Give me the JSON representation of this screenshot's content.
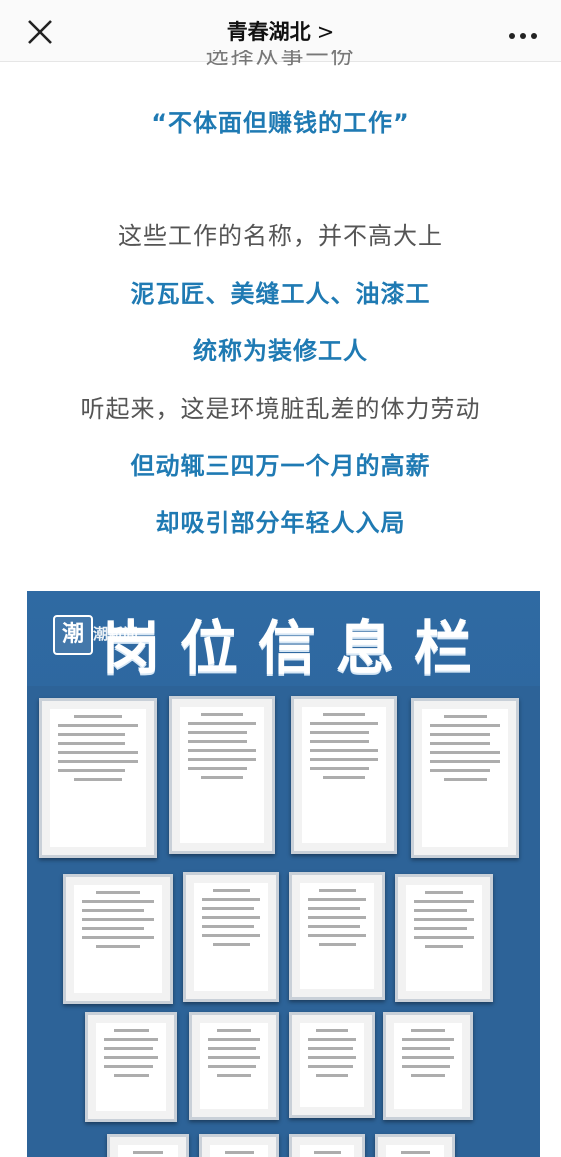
{
  "header": {
    "title": "青春湖北",
    "title_chevron": ">",
    "close_icon": "close-icon",
    "more_icon": "more-icon"
  },
  "article": {
    "cut_line": "选择从事一份",
    "lines": [
      "“不体面但赚钱的工作”",
      "这些工作的名称，并不高大上",
      "泥瓦匠、美缝工人、油漆工",
      "统称为装修工人",
      "听起来，这是环境脏乱差的体力劳动",
      "但动辄三四万一个月的高薪",
      "却吸引部分年轻人入局"
    ]
  },
  "photo": {
    "logo_char": "潮",
    "logo_text": "潮新闻",
    "banner": "岗位信息栏"
  },
  "colors": {
    "accent_blue": "#1f7ab3",
    "body_gray": "#555555",
    "board_blue": "#2d6398"
  }
}
